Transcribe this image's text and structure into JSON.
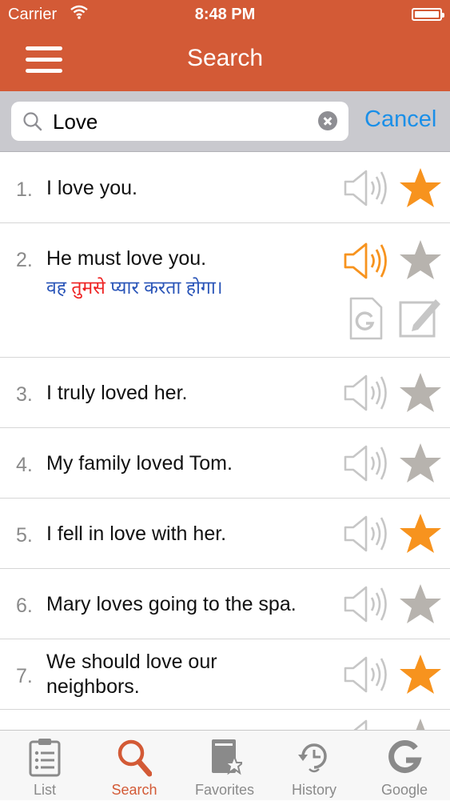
{
  "status_bar": {
    "carrier": "Carrier",
    "time": "8:48 PM"
  },
  "navbar": {
    "title": "Search",
    "menu_icon": "hamburger-menu-icon"
  },
  "search": {
    "value": "Love",
    "cancel_label": "Cancel",
    "icon": "search-icon",
    "clear_icon": "clear-icon"
  },
  "colors": {
    "accent": "#d35a36",
    "star_on": "#f7931e",
    "star_off": "#b7b3ae",
    "speaker_off": "#c6c6c6",
    "speaker_on": "#f7931e",
    "link": "#1a8fe8",
    "translation": "#2a55b8",
    "highlight": "#e22222"
  },
  "sentences": [
    {
      "num": "1.",
      "text": "I love you.",
      "favorite": true,
      "playing": false
    },
    {
      "num": "2.",
      "text": "He must love you.",
      "favorite": false,
      "playing": true,
      "translation": {
        "before": "वह ",
        "highlight": "तुमसे",
        "after": " प्यार करता होगा।"
      }
    },
    {
      "num": "3.",
      "text": "I truly loved her.",
      "favorite": false,
      "playing": false
    },
    {
      "num": "4.",
      "text": "My family loved Tom.",
      "favorite": false,
      "playing": false
    },
    {
      "num": "5.",
      "text": "I fell in love with her.",
      "favorite": true,
      "playing": false
    },
    {
      "num": "6.",
      "text": "Mary loves going to the spa.",
      "favorite": false,
      "playing": false
    },
    {
      "num": "7.",
      "text": "We should love our neighbors.",
      "favorite": true,
      "playing": false
    }
  ],
  "tabs": [
    {
      "label": "List",
      "icon": "clipboard-list-icon",
      "active": false
    },
    {
      "label": "Search",
      "icon": "search-icon",
      "active": true
    },
    {
      "label": "Favorites",
      "icon": "book-star-icon",
      "active": false
    },
    {
      "label": "History",
      "icon": "history-clock-icon",
      "active": false
    },
    {
      "label": "Google",
      "icon": "google-g-icon",
      "active": false
    }
  ]
}
